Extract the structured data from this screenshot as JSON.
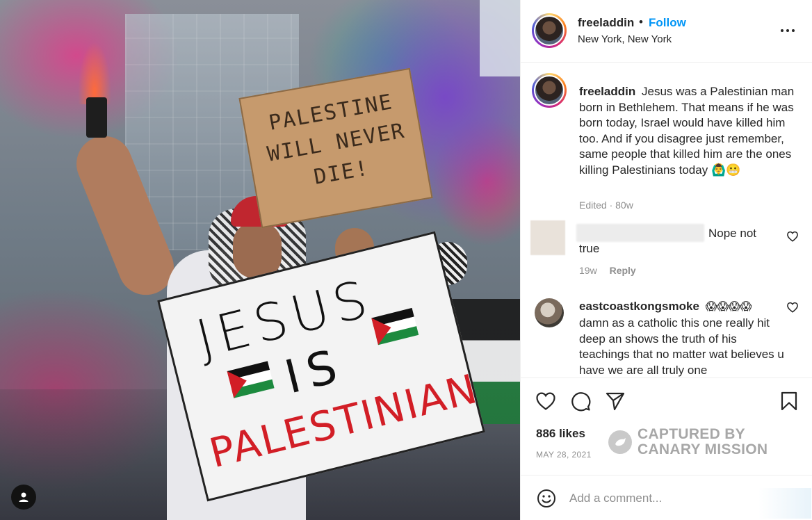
{
  "post": {
    "username": "freeladdin",
    "separator": "•",
    "follow_label": "Follow",
    "location": "New York, New York",
    "caption": "Jesus was a Palestinian man born in Bethlehem. That means if he was born today, Israel would have killed him too. And if you disagree just remember, same people that killed him are the ones killing Palestinians today 🙆‍♂️😬",
    "caption_meta": "Edited · 80w"
  },
  "photo": {
    "cardboard_sign": "PALESTINE WILL NEVER DIE!",
    "poster_line1": "JESUS",
    "poster_line2": "IS",
    "poster_line3": "PALESTINIAN"
  },
  "comments": [
    {
      "text_part1": "Nope not",
      "text_part2": "true",
      "age": "19w",
      "reply_label": "Reply"
    },
    {
      "username": "eastcoastkongsmoke",
      "emoji": "😱😱😱😱",
      "text": "damn as a catholic this one really hit deep an shows the truth of his teachings that no matter wat believes u have we are all truly one"
    }
  ],
  "actions": {
    "likes": "886 likes",
    "date": "MAY 28, 2021"
  },
  "watermark": {
    "line1": "CAPTURED BY",
    "line2": "CANARY MISSION"
  },
  "composer": {
    "placeholder": "Add a comment..."
  },
  "icons": {
    "more": "more-options-icon",
    "like": "heart-icon",
    "comment": "comment-bubble-icon",
    "share": "paper-plane-icon",
    "save": "bookmark-icon",
    "emoji": "smiley-icon",
    "user_tag": "user-tag-icon"
  }
}
